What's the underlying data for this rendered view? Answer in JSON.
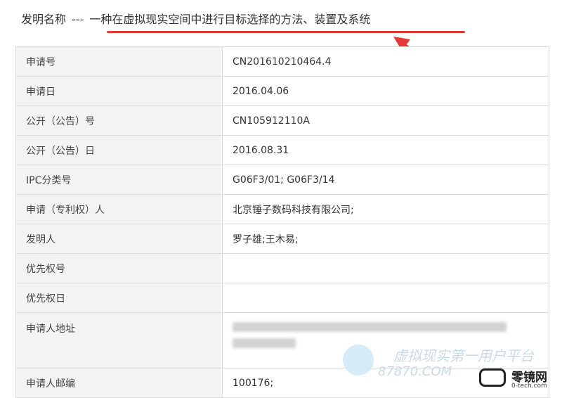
{
  "header": {
    "label": "发明名称",
    "separator": "---",
    "title": "一种在虚拟现实空间中进行目标选择的方法、装置及系统"
  },
  "table": {
    "rows": [
      {
        "label": "申请号",
        "value": "CN201610210464.4"
      },
      {
        "label": "申请日",
        "value": "2016.04.06"
      },
      {
        "label": "公开（公告）号",
        "value": "CN105912110A"
      },
      {
        "label": "公开（公告）日",
        "value": "2016.08.31"
      },
      {
        "label": "IPC分类号",
        "value": "G06F3/01; G06F3/14"
      },
      {
        "label": "申请（专利权）人",
        "value": "北京锤子数码科技有限公司;"
      },
      {
        "label": "发明人",
        "value": "罗子雄;王木易;"
      },
      {
        "label": "优先权号",
        "value": ""
      },
      {
        "label": "优先权日",
        "value": ""
      },
      {
        "label": "申请人地址",
        "value": ""
      },
      {
        "label": "申请人邮编",
        "value": "100176;"
      }
    ]
  },
  "watermark": {
    "line1": "虚拟现实第一用户平台",
    "line2": "87870.COM"
  },
  "brand": {
    "name": "零镜网",
    "url": "0-tech.com"
  },
  "colors": {
    "accent_red": "#e53935",
    "label_bg": "#f3f3f3",
    "border": "#dcdcdc"
  }
}
